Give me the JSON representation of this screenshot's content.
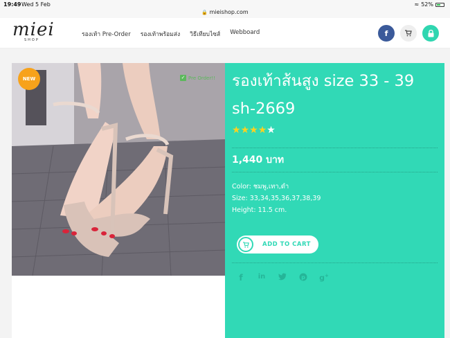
{
  "status": {
    "time": "19:49",
    "date": "Wed 5 Feb",
    "battery": "52%",
    "battery_level": 0.52,
    "url": "mieishop.com"
  },
  "header": {
    "logo_text": "miei",
    "logo_sub": "SHOP",
    "nav": [
      "รองเท้า Pre-Order",
      "รองเท้าพร้อมส่ง",
      "วิธีเทียบไซส์",
      "Webboard"
    ],
    "icons": [
      "facebook-icon",
      "cart-icon",
      "lock-icon"
    ]
  },
  "product": {
    "badge": "NEW",
    "preorder_label": "Pre Order!!",
    "title_line1": "รองเท้าส้นสูง size 33 - 39",
    "title_line2": "sh-2669",
    "rating": 4,
    "rating_max": 5,
    "price": "1,440 บาท",
    "color": "Color: ชมพู,เทา,ดำ",
    "size": "Size: 33,34,35,36,37,38,39",
    "height": "Height: 11.5 cm.",
    "add_to_cart": "ADD TO CART",
    "share_icons": [
      "facebook-icon",
      "linkedin-icon",
      "twitter-icon",
      "pinterest-icon",
      "google-plus-icon"
    ]
  },
  "colors": {
    "accent": "#31d9b6",
    "badge": "#f7a21b",
    "facebook": "#3b5a9a",
    "star": "#ffd21f"
  }
}
